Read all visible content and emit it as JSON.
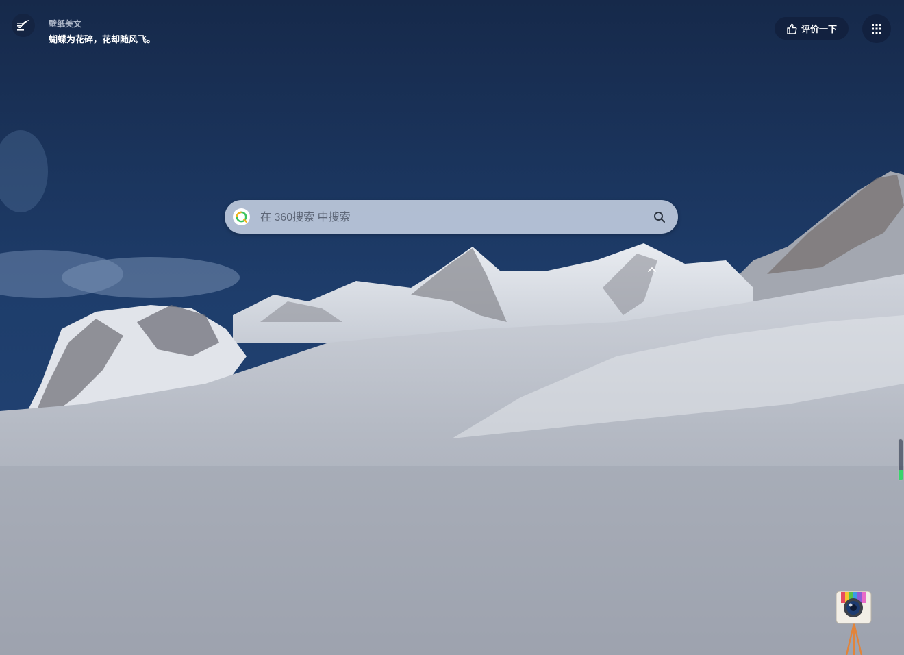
{
  "quote": {
    "title": "壁纸美文",
    "text": "蝴蝶为花碎，花却随风飞。"
  },
  "header": {
    "rate_label": "评价一下"
  },
  "search": {
    "placeholder": "在 360搜索 中搜索",
    "value": ""
  },
  "icons": {
    "quote": "quill-icon",
    "rate": "thumbs-up-icon",
    "apps": "grid-dots-icon",
    "engine": "360-search-logo",
    "submit": "search-icon",
    "collapse": "chevron-up-icon",
    "camera": "camera-widget-icon"
  },
  "scroll": {
    "fill_fraction": 0.25
  },
  "colors": {
    "sky_top": "#172a4a",
    "sky_mid": "#1e3c6c",
    "snow": "#b8bcc6",
    "accent_green": "#39d46b"
  }
}
